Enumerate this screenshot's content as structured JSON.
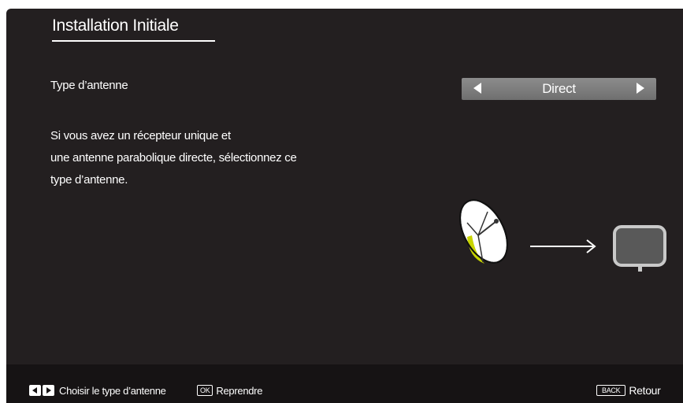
{
  "title": "Installation Initiale",
  "antenna": {
    "label": "Type d’antenne",
    "selected_value": "Direct"
  },
  "description": [
    "Si vous avez un récepteur unique et",
    "une antenne parabolique directe, sélectionnez ce",
    "type d’antenne."
  ],
  "footer": {
    "choose_label": "Choisir le type d’antenne",
    "ok_key": "OK",
    "resume_label": "Reprendre",
    "back_key": "BACK",
    "back_label": "Retour"
  },
  "icons": {
    "dish": "satellite-dish-icon",
    "arrow": "arrow-right-icon",
    "tv": "tv-monitor-icon",
    "left": "triangle-left-icon",
    "right": "triangle-right-icon"
  },
  "colors": {
    "background": "#231f20",
    "footer": "#161314",
    "selector": "#7f7f7f",
    "dish_accent": "#c8d400"
  }
}
